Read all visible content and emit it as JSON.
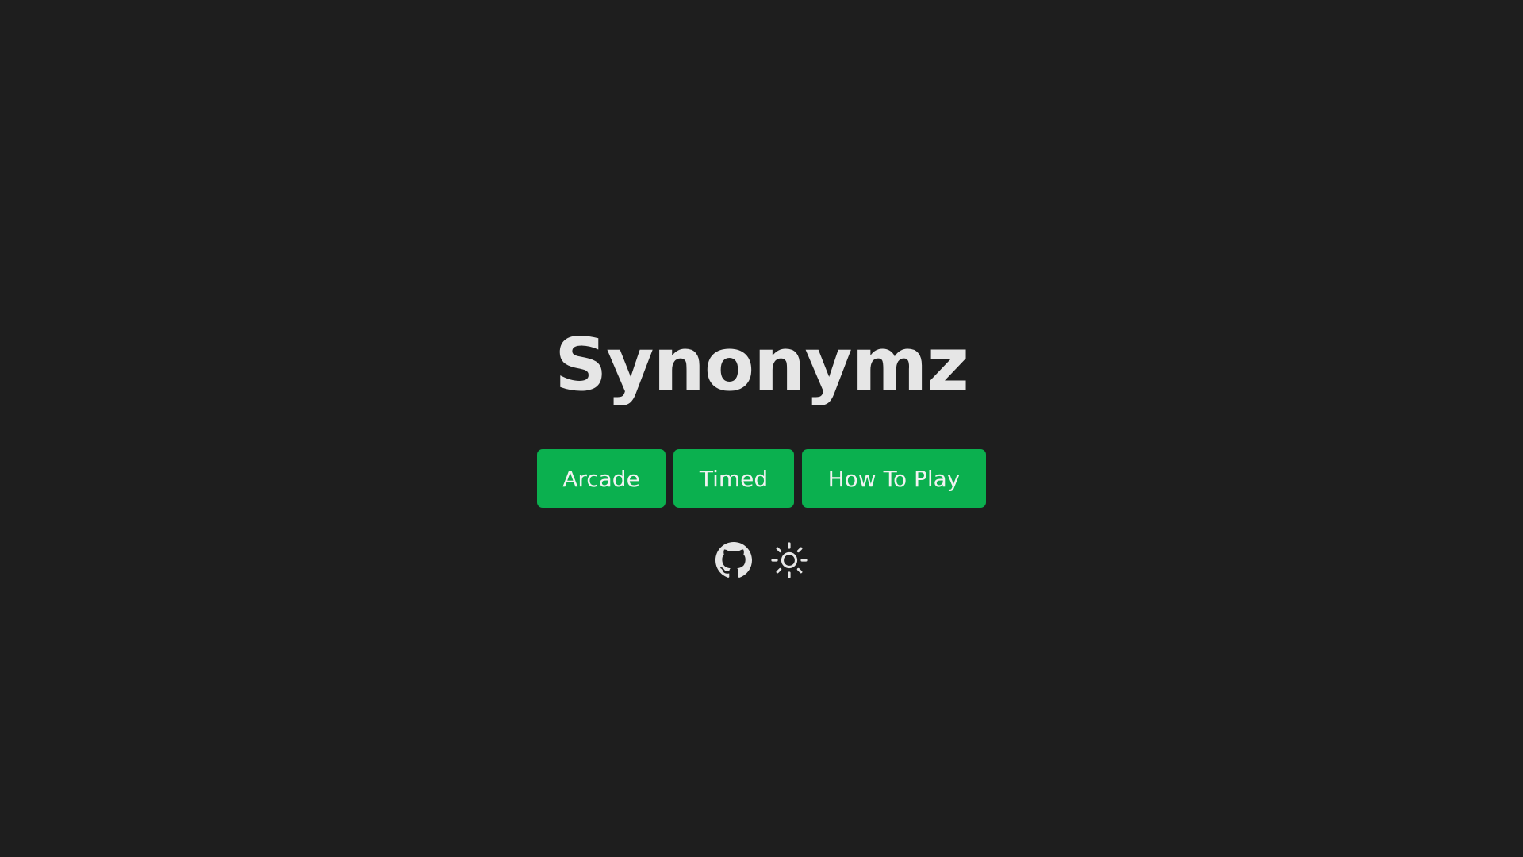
{
  "app": {
    "title": "Synonymz"
  },
  "menu": {
    "buttons": [
      {
        "label": "Arcade"
      },
      {
        "label": "Timed"
      },
      {
        "label": "How To Play"
      }
    ]
  },
  "footer_icons": [
    {
      "icon": "github-icon"
    },
    {
      "icon": "sun-icon"
    }
  ],
  "colors": {
    "background": "#1e1e1e",
    "accent": "#0bb04f",
    "text": "#e6e6e6"
  }
}
